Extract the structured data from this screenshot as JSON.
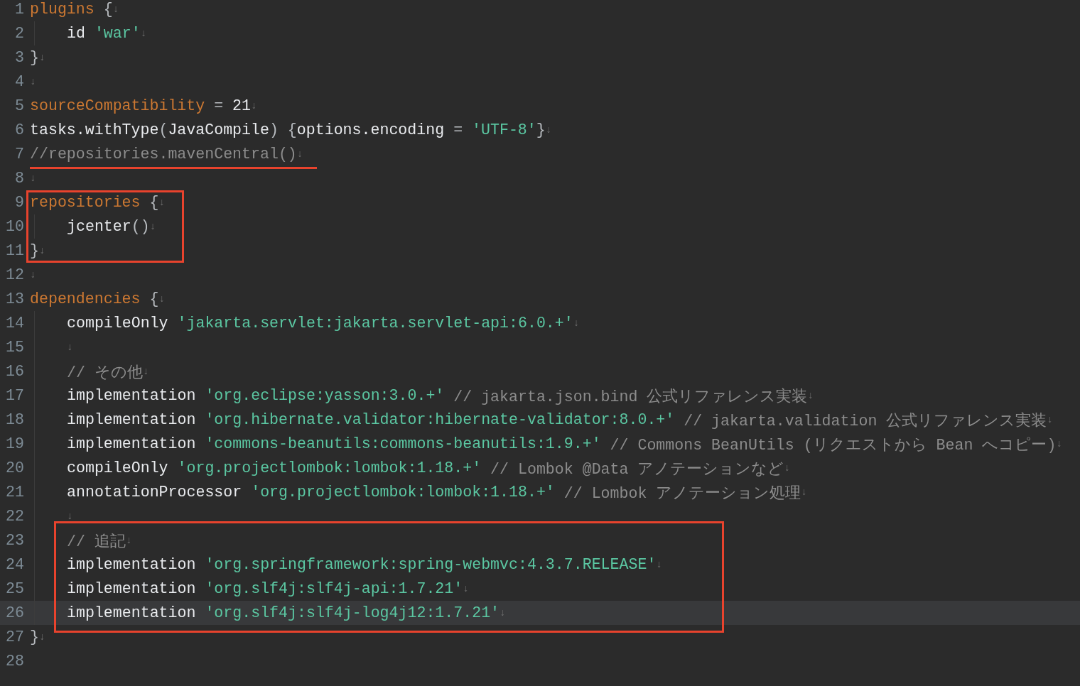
{
  "editor": {
    "blocks": [
      {
        "kind": "plain",
        "lines": [
          {
            "number": "1",
            "indented": false,
            "current": false,
            "tokens": [
              {
                "kind": "keyword",
                "text": "plugins"
              },
              {
                "kind": "punct",
                "text": " {"
              },
              {
                "kind": "eol",
                "text": "↓"
              }
            ]
          },
          {
            "number": "2",
            "indented": true,
            "current": false,
            "tokens": [
              {
                "kind": "plain",
                "text": "id "
              },
              {
                "kind": "string",
                "text": "'war'"
              },
              {
                "kind": "eol",
                "text": "↓"
              }
            ]
          },
          {
            "number": "3",
            "indented": false,
            "current": false,
            "tokens": [
              {
                "kind": "punct",
                "text": "}"
              },
              {
                "kind": "eol",
                "text": "↓"
              }
            ]
          },
          {
            "number": "4",
            "indented": false,
            "current": false,
            "tokens": [
              {
                "kind": "eol",
                "text": "↓"
              }
            ]
          },
          {
            "number": "5",
            "indented": false,
            "current": false,
            "tokens": [
              {
                "kind": "keyword",
                "text": "sourceCompatibility"
              },
              {
                "kind": "punct",
                "text": " = "
              },
              {
                "kind": "plain",
                "text": "21"
              },
              {
                "kind": "eol",
                "text": "↓"
              }
            ]
          },
          {
            "number": "6",
            "indented": false,
            "current": false,
            "tokens": [
              {
                "kind": "plain",
                "text": "tasks.withType"
              },
              {
                "kind": "punct",
                "text": "("
              },
              {
                "kind": "plain",
                "text": "JavaCompile"
              },
              {
                "kind": "punct",
                "text": ") {"
              },
              {
                "kind": "plain",
                "text": "options.encoding"
              },
              {
                "kind": "punct",
                "text": " = "
              },
              {
                "kind": "string",
                "text": "'UTF-8'"
              },
              {
                "kind": "punct",
                "text": "}"
              },
              {
                "kind": "eol",
                "text": "↓"
              }
            ]
          }
        ]
      },
      {
        "kind": "underlined",
        "lines": [
          {
            "number": "7",
            "indented": false,
            "current": false,
            "tokens": [
              {
                "kind": "comment",
                "text": "//repositories.mavenCentral()"
              },
              {
                "kind": "eol",
                "text": "↓"
              }
            ]
          }
        ]
      },
      {
        "kind": "plain",
        "lines": [
          {
            "number": "8",
            "indented": false,
            "current": false,
            "tokens": [
              {
                "kind": "eol",
                "text": "↓"
              }
            ]
          }
        ]
      },
      {
        "kind": "boxed",
        "lines": [
          {
            "number": "9",
            "indented": false,
            "current": false,
            "tokens": [
              {
                "kind": "keyword",
                "text": "repositories"
              },
              {
                "kind": "punct",
                "text": " {"
              },
              {
                "kind": "eol",
                "text": "↓"
              }
            ]
          },
          {
            "number": "10",
            "indented": true,
            "current": false,
            "tokens": [
              {
                "kind": "plain",
                "text": "jcenter"
              },
              {
                "kind": "punct",
                "text": "()"
              },
              {
                "kind": "eol",
                "text": "↓"
              }
            ]
          },
          {
            "number": "11",
            "indented": false,
            "current": false,
            "tokens": [
              {
                "kind": "punct",
                "text": "}"
              },
              {
                "kind": "eol",
                "text": "↓"
              }
            ]
          }
        ]
      },
      {
        "kind": "plain",
        "lines": [
          {
            "number": "12",
            "indented": false,
            "current": false,
            "tokens": [
              {
                "kind": "eol",
                "text": "↓"
              }
            ]
          },
          {
            "number": "13",
            "indented": false,
            "current": false,
            "tokens": [
              {
                "kind": "keyword",
                "text": "dependencies"
              },
              {
                "kind": "punct",
                "text": " {"
              },
              {
                "kind": "eol",
                "text": "↓"
              }
            ]
          },
          {
            "number": "14",
            "indented": true,
            "current": false,
            "tokens": [
              {
                "kind": "plain",
                "text": "compileOnly "
              },
              {
                "kind": "string",
                "text": "'jakarta.servlet:jakarta.servlet-api:6.0.+'"
              },
              {
                "kind": "eol",
                "text": "↓"
              }
            ]
          },
          {
            "number": "15",
            "indented": true,
            "current": false,
            "tokens": [
              {
                "kind": "eol",
                "text": "↓"
              }
            ]
          },
          {
            "number": "16",
            "indented": true,
            "current": false,
            "tokens": [
              {
                "kind": "comment",
                "text": "// その他"
              },
              {
                "kind": "eol",
                "text": "↓"
              }
            ]
          },
          {
            "number": "17",
            "indented": true,
            "current": false,
            "tokens": [
              {
                "kind": "plain",
                "text": "implementation "
              },
              {
                "kind": "string",
                "text": "'org.eclipse:yasson:3.0.+'"
              },
              {
                "kind": "comment",
                "text": " // jakarta.json.bind 公式リファレンス実装"
              },
              {
                "kind": "eol",
                "text": "↓"
              }
            ]
          },
          {
            "number": "18",
            "indented": true,
            "current": false,
            "tokens": [
              {
                "kind": "plain",
                "text": "implementation "
              },
              {
                "kind": "string",
                "text": "'org.hibernate.validator:hibernate-validator:8.0.+'"
              },
              {
                "kind": "comment",
                "text": " // jakarta.validation 公式リファレンス実装"
              },
              {
                "kind": "eol",
                "text": "↓"
              }
            ]
          },
          {
            "number": "19",
            "indented": true,
            "current": false,
            "tokens": [
              {
                "kind": "plain",
                "text": "implementation "
              },
              {
                "kind": "string",
                "text": "'commons-beanutils:commons-beanutils:1.9.+'"
              },
              {
                "kind": "comment",
                "text": " // Commons BeanUtils (リクエストから Bean へコピー)"
              },
              {
                "kind": "eol",
                "text": "↓"
              }
            ]
          },
          {
            "number": "20",
            "indented": true,
            "current": false,
            "tokens": [
              {
                "kind": "plain",
                "text": "compileOnly "
              },
              {
                "kind": "string",
                "text": "'org.projectlombok:lombok:1.18.+'"
              },
              {
                "kind": "comment",
                "text": " // Lombok @Data アノテーションなど"
              },
              {
                "kind": "eol",
                "text": "↓"
              }
            ]
          },
          {
            "number": "21",
            "indented": true,
            "current": false,
            "tokens": [
              {
                "kind": "plain",
                "text": "annotationProcessor "
              },
              {
                "kind": "string",
                "text": "'org.projectlombok:lombok:1.18.+'"
              },
              {
                "kind": "comment",
                "text": " // Lombok アノテーション処理"
              },
              {
                "kind": "eol",
                "text": "↓"
              }
            ]
          },
          {
            "number": "22",
            "indented": true,
            "current": false,
            "tokens": [
              {
                "kind": "eol",
                "text": "↓"
              }
            ]
          }
        ]
      },
      {
        "kind": "boxed",
        "lines": [
          {
            "number": "23",
            "indented": true,
            "current": false,
            "tokens": [
              {
                "kind": "comment",
                "text": "// 追記"
              },
              {
                "kind": "eol",
                "text": "↓"
              }
            ]
          },
          {
            "number": "24",
            "indented": true,
            "current": false,
            "tokens": [
              {
                "kind": "plain",
                "text": "implementation "
              },
              {
                "kind": "string",
                "text": "'org.springframework:spring-webmvc:4.3.7.RELEASE'"
              },
              {
                "kind": "eol",
                "text": "↓"
              }
            ]
          },
          {
            "number": "25",
            "indented": true,
            "current": false,
            "tokens": [
              {
                "kind": "plain",
                "text": "implementation "
              },
              {
                "kind": "string",
                "text": "'org.slf4j:slf4j-api:1.7.21'"
              },
              {
                "kind": "eol",
                "text": "↓"
              }
            ]
          },
          {
            "number": "26",
            "indented": true,
            "current": true,
            "tokens": [
              {
                "kind": "plain",
                "text": "implementation "
              },
              {
                "kind": "string",
                "text": "'org.slf4j:slf4j-log4j12:1.7.21'"
              },
              {
                "kind": "eol",
                "text": "↓"
              }
            ]
          }
        ]
      },
      {
        "kind": "plain",
        "lines": [
          {
            "number": "27",
            "indented": false,
            "current": false,
            "tokens": [
              {
                "kind": "punct",
                "text": "}"
              },
              {
                "kind": "eol",
                "text": "↓"
              }
            ]
          },
          {
            "number": "28",
            "indented": false,
            "current": false
          }
        ]
      }
    ]
  }
}
